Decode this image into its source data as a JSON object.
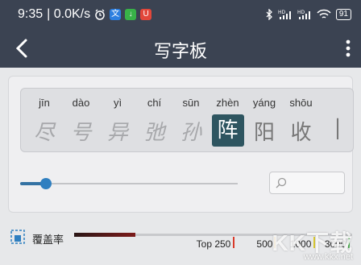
{
  "status_bar": {
    "time": "9:35",
    "net_speed": "| 0.0K/s",
    "app_icons": [
      "alarm-icon",
      "translate-app-icon",
      "download-app-icon",
      "shop-app-icon"
    ],
    "system_icons": [
      "bluetooth-icon",
      "hd-signal-icon",
      "hd-signal-icon",
      "wifi-icon"
    ],
    "battery": "91"
  },
  "app_bar": {
    "title": "写字板",
    "back_icon": "back-arrow-icon",
    "more_icon": "more-vert-icon"
  },
  "candidates": [
    {
      "pinyin": "jīn",
      "char": "尽",
      "style": "faint"
    },
    {
      "pinyin": "dào",
      "char": "号",
      "style": "faint"
    },
    {
      "pinyin": "yì",
      "char": "异",
      "style": "faint"
    },
    {
      "pinyin": "chí",
      "char": "弛",
      "style": "faint"
    },
    {
      "pinyin": "sūn",
      "char": "孙",
      "style": "faint"
    },
    {
      "pinyin": "zhèn",
      "char": "阵",
      "style": "selected"
    },
    {
      "pinyin": "yáng",
      "char": "阳",
      "style": "normal"
    },
    {
      "pinyin": "shōu",
      "char": "收",
      "style": "normal"
    },
    {
      "pinyin": "",
      "char": "|",
      "style": "normal"
    }
  ],
  "size_slider": {
    "value": 0.12
  },
  "search": {
    "placeholder": ""
  },
  "coverage": {
    "label": "覆盖率",
    "fill": 0.22,
    "markers": [
      {
        "label": "Top 250",
        "color": "#d93a2b",
        "pos": 0.57
      },
      {
        "label": "500",
        "color": "#e8a92e",
        "pos": 0.72
      },
      {
        "label": "1000",
        "color": "#d8c832",
        "pos": 0.86
      },
      {
        "label": "3000",
        "color": "#4caf50",
        "pos": 0.985
      }
    ]
  },
  "watermark": {
    "text": "KK下载",
    "url": "www.kkx.net"
  }
}
